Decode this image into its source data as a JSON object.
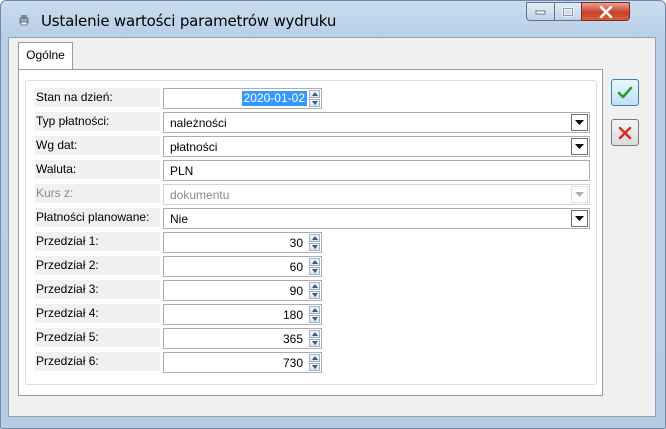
{
  "window": {
    "title": "Ustalenie wartości parametrów wydruku",
    "minimize_icon": "minimize-icon",
    "maximize_icon": "maximize-icon",
    "close_icon": "close-icon"
  },
  "tabs": [
    {
      "label": "Ogólne",
      "active": true
    }
  ],
  "form": {
    "stan_label": "Stan na dzień:",
    "stan_value": "2020-01-02",
    "typ_label": "Typ płatności:",
    "typ_value": "należności",
    "wg_label": "Wg dat:",
    "wg_value": "płatności",
    "waluta_label": "Waluta:",
    "waluta_value": "PLN",
    "kurs_label": "Kurs z:",
    "kurs_value": "dokumentu",
    "plat_label": "Płatności planowane:",
    "plat_value": "Nie",
    "przedzialy": [
      {
        "label": "Przedział 1:",
        "value": "30"
      },
      {
        "label": "Przedział 2:",
        "value": "60"
      },
      {
        "label": "Przedział 3:",
        "value": "90"
      },
      {
        "label": "Przedział 4:",
        "value": "180"
      },
      {
        "label": "Przedział 5:",
        "value": "365"
      },
      {
        "label": "Przedział 6:",
        "value": "730"
      }
    ]
  },
  "actions": {
    "ok_icon": "checkmark-icon",
    "cancel_icon": "x-icon"
  },
  "colors": {
    "ok_check": "#2e9a2e",
    "cancel_x": "#d62a1e",
    "selection": "#3399ff"
  }
}
